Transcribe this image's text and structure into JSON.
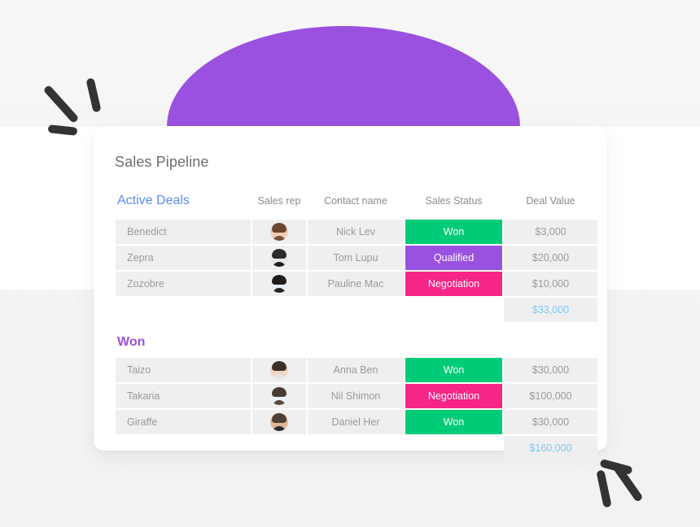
{
  "page": {
    "background_color": "#f5f5f5",
    "decor": {
      "arc_color": "#9b51e0",
      "scribble_color": "#333333",
      "scribble_top_left_name": "sparkle-scribble-top-left",
      "scribble_bottom_right_name": "sparkle-scribble-bottom-right"
    }
  },
  "card": {
    "title": "Sales Pipeline",
    "background_color": "#ffffff"
  },
  "colors": {
    "header_active": "#5b8def",
    "header_won": "#9b51e0",
    "status_won": "#00cc77",
    "status_qualified": "#9b51e0",
    "status_negotiation": "#f72585",
    "total_value": "#7ec8f5",
    "cell_background": "#efefef",
    "muted_text": "#9a9a9a"
  },
  "table": {
    "columns": [
      {
        "key": "deal",
        "label": ""
      },
      {
        "key": "rep",
        "label": "Sales rep"
      },
      {
        "key": "contact",
        "label": "Contact name"
      },
      {
        "key": "status",
        "label": "Sales Status"
      },
      {
        "key": "value",
        "label": "Deal Value"
      }
    ],
    "groups": [
      {
        "name": "Active Deals",
        "rows": [
          {
            "deal": "Benedict",
            "rep_avatar": "avatar-woman-brown-hair",
            "contact": "Nick Lev",
            "status": "Won",
            "status_color": "#00cc77",
            "value": "$3,000"
          },
          {
            "deal": "Zepra",
            "rep_avatar": "avatar-man-suit-bw",
            "contact": "Tom Lupu",
            "status": "Qualified",
            "status_color": "#9b51e0",
            "value": "$20,000"
          },
          {
            "deal": "Zozobre",
            "rep_avatar": "avatar-woman-dark-hair",
            "contact": "Pauline Mac",
            "status": "Negotiation",
            "status_color": "#f72585",
            "value": "$10,000"
          }
        ],
        "total": "$33,000"
      },
      {
        "name": "Won",
        "rows": [
          {
            "deal": "Taizo",
            "rep_avatar": "avatar-man-glasses",
            "contact": "Anna Ben",
            "status": "Won",
            "status_color": "#00cc77",
            "value": "$30,000"
          },
          {
            "deal": "Takaria",
            "rep_avatar": "avatar-woman-curly-hair",
            "contact": "Nil Shimon",
            "status": "Negotiation",
            "status_color": "#f72585",
            "value": "$100,000"
          },
          {
            "deal": "Giraffe",
            "rep_avatar": "avatar-man-beard",
            "contact": "Daniel Her",
            "status": "Won",
            "status_color": "#00cc77",
            "value": "$30,000"
          }
        ],
        "total": "$160,000"
      }
    ]
  }
}
